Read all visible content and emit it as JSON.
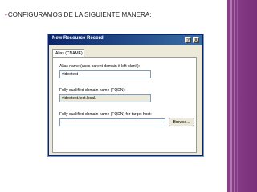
{
  "slide": {
    "bullet": "•",
    "title": "CONFIGURAMOS DE LA SIGUIENTE MANERA:"
  },
  "dialog": {
    "title": "New Resource Record",
    "help_label": "?",
    "close_label": "X",
    "tab_label": "Alias (CNAME)",
    "alias_label": "Alias name (uses parent domain if left blank):",
    "alias_value": "videotest",
    "fqdn_label": "Fully qualified domain name (FQDN):",
    "fqdn_value": "videotest.test.local.",
    "target_label": "Fully qualified domain name (FQDN) for target host:",
    "target_value": "",
    "browse_label": "Browse..."
  },
  "colors": {
    "accent_bar": "#8a3f8a",
    "titlebar": "#0a246a"
  }
}
